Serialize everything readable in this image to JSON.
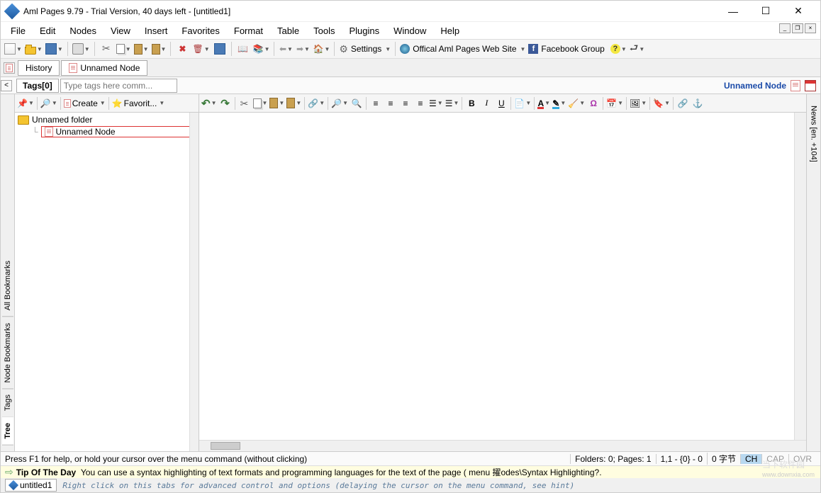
{
  "titlebar": {
    "title": "Aml Pages 9.79 - Trial Version, 40 days left - [untitled1]"
  },
  "menu": {
    "items": [
      "File",
      "Edit",
      "Nodes",
      "View",
      "Insert",
      "Favorites",
      "Format",
      "Table",
      "Tools",
      "Plugins",
      "Window",
      "Help"
    ]
  },
  "toolbar": {
    "settings": "Settings",
    "website": "Offical Aml Pages Web Site",
    "fbgroup": "Facebook Group"
  },
  "tabs": {
    "history": "History",
    "current": "Unnamed Node"
  },
  "tags": {
    "label": "Tags[0]",
    "placeholder": "Type tags here comm...",
    "title": "Unnamed Node"
  },
  "tree": {
    "toolbar": {
      "create": "Create",
      "favorite": "Favorit..."
    },
    "folder": "Unnamed folder",
    "node": "Unnamed Node"
  },
  "left_tabs": [
    "All Bookmarks",
    "Node Bookmarks",
    "Tags",
    "Tree"
  ],
  "right_tab": "News [en. +104]",
  "status": {
    "help": "Press F1 for help, or hold your cursor over the menu command (without clicking)",
    "folders": "Folders: 0; Pages: 1",
    "pos": "1,1 - {0} - 0",
    "bytes": "0 字节",
    "ch": "CH",
    "cap": "CAP",
    "ovr": "OVR"
  },
  "tip": {
    "title": "Tip Of The Day",
    "text": "You can use a syntax highlighting of text formats and programming languages for the text of the page ( menu 擢odes\\Syntax Highlighting?."
  },
  "doc": {
    "name": "untitled1",
    "hint": "Right click on this tabs for advanced control and options (delaying the cursor on the menu command, see hint)"
  },
  "watermark": {
    "name": "当下软件园",
    "url": "www.downxia.com"
  }
}
